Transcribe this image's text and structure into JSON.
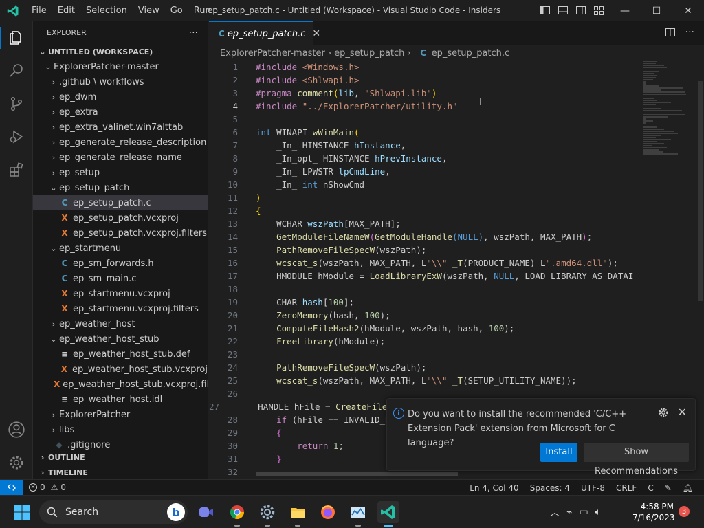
{
  "titlebar": {
    "menu": [
      "File",
      "Edit",
      "Selection",
      "View",
      "Go",
      "Run",
      "···"
    ],
    "title": "ep_setup_patch.c - Untitled (Workspace) - Visual Studio Code - Insiders"
  },
  "sidebar": {
    "title": "EXPLORER",
    "more": "···",
    "workspace": "UNTITLED (WORKSPACE)",
    "items": [
      {
        "label": "ExplorerPatcher-master",
        "depth": 1,
        "chevron": "⌄",
        "icon": ""
      },
      {
        "label": ".github \\ workflows",
        "depth": 2,
        "chevron": "›",
        "icon": ""
      },
      {
        "label": "ep_dwm",
        "depth": 2,
        "chevron": "›",
        "icon": ""
      },
      {
        "label": "ep_extra",
        "depth": 2,
        "chevron": "›",
        "icon": ""
      },
      {
        "label": "ep_extra_valinet.win7alttab",
        "depth": 2,
        "chevron": "›",
        "icon": ""
      },
      {
        "label": "ep_generate_release_description",
        "depth": 2,
        "chevron": "›",
        "icon": ""
      },
      {
        "label": "ep_generate_release_name",
        "depth": 2,
        "chevron": "›",
        "icon": ""
      },
      {
        "label": "ep_setup",
        "depth": 2,
        "chevron": "›",
        "icon": ""
      },
      {
        "label": "ep_setup_patch",
        "depth": 2,
        "chevron": "⌄",
        "icon": ""
      },
      {
        "label": "ep_setup_patch.c",
        "depth": 3,
        "chevron": "",
        "icon": "C",
        "selected": true
      },
      {
        "label": "ep_setup_patch.vcxproj",
        "depth": 3,
        "chevron": "",
        "icon": "X"
      },
      {
        "label": "ep_setup_patch.vcxproj.filters",
        "depth": 3,
        "chevron": "",
        "icon": "X"
      },
      {
        "label": "ep_startmenu",
        "depth": 2,
        "chevron": "⌄",
        "icon": ""
      },
      {
        "label": "ep_sm_forwards.h",
        "depth": 3,
        "chevron": "",
        "icon": "C"
      },
      {
        "label": "ep_sm_main.c",
        "depth": 3,
        "chevron": "",
        "icon": "C"
      },
      {
        "label": "ep_startmenu.vcxproj",
        "depth": 3,
        "chevron": "",
        "icon": "X"
      },
      {
        "label": "ep_startmenu.vcxproj.filters",
        "depth": 3,
        "chevron": "",
        "icon": "X"
      },
      {
        "label": "ep_weather_host",
        "depth": 2,
        "chevron": "›",
        "icon": ""
      },
      {
        "label": "ep_weather_host_stub",
        "depth": 2,
        "chevron": "⌄",
        "icon": ""
      },
      {
        "label": "ep_weather_host_stub.def",
        "depth": 3,
        "chevron": "",
        "icon": "≡"
      },
      {
        "label": "ep_weather_host_stub.vcxproj",
        "depth": 3,
        "chevron": "",
        "icon": "X"
      },
      {
        "label": "ep_weather_host_stub.vcxproj.filters",
        "depth": 3,
        "chevron": "",
        "icon": "X"
      },
      {
        "label": "ep_weather_host.idl",
        "depth": 3,
        "chevron": "",
        "icon": "≡"
      },
      {
        "label": "ExplorerPatcher",
        "depth": 2,
        "chevron": "›",
        "icon": ""
      },
      {
        "label": "libs",
        "depth": 2,
        "chevron": "›",
        "icon": ""
      },
      {
        "label": ".gitignore",
        "depth": 2,
        "chevron": "",
        "icon": "◆"
      }
    ],
    "outline": "OUTLINE",
    "timeline": "TIMELINE"
  },
  "editor": {
    "tab": {
      "icon": "C",
      "label": "ep_setup_patch.c"
    },
    "breadcrumb": [
      "ExplorerPatcher-master",
      "ep_setup_patch",
      "ep_setup_patch.c"
    ],
    "current_line": 4
  },
  "notification": {
    "message": "Do you want to install the recommended 'C/C++ Extension Pack' extension from Microsoft for C language?",
    "install": "Install",
    "show_recommendations": "Show Recommendations"
  },
  "statusbar": {
    "problems": "0",
    "warnings": "0",
    "position": "Ln 4, Col 40",
    "spaces": "Spaces: 4",
    "encoding": "UTF-8",
    "eol": "CRLF",
    "language": "C"
  },
  "taskbar": {
    "search": "Search",
    "time": "4:58 PM",
    "date": "7/16/2023",
    "badge": "3"
  },
  "colors": {
    "accent": "#0078d4",
    "c_icon": "#519aba",
    "xml_icon": "#e37933"
  }
}
